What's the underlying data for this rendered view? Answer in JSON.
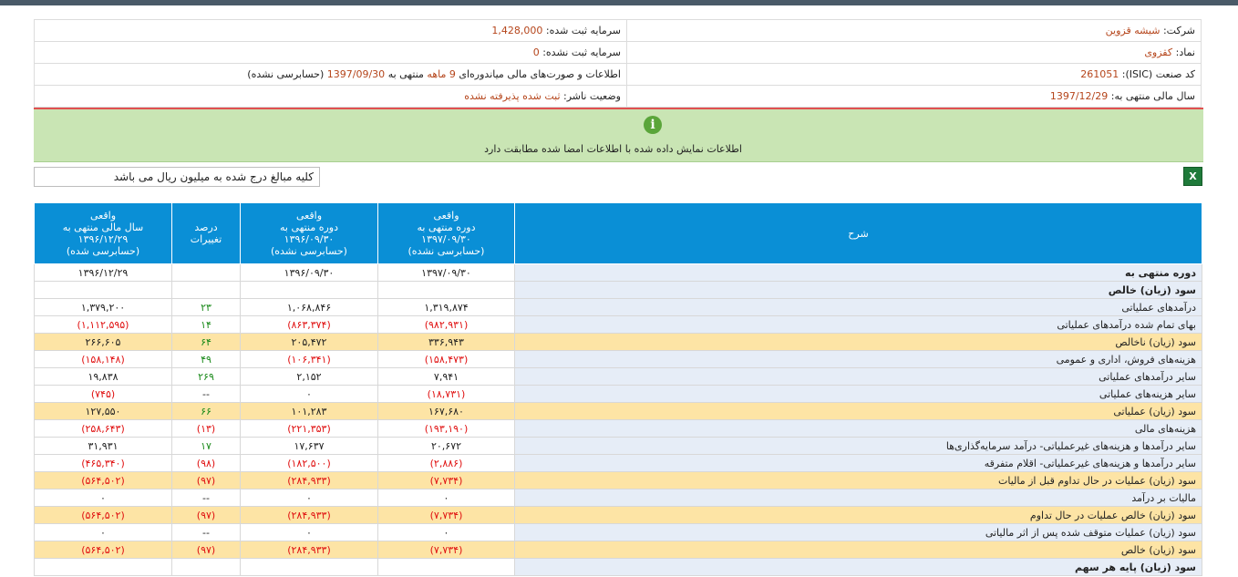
{
  "company": {
    "name_label": "شرکت:",
    "name_value": "شیشه قزوین",
    "capital_label": "سرمایه ثبت شده:",
    "capital_value": "1,428,000",
    "symbol_label": "نماد:",
    "symbol_value": "کقزوی",
    "unreg_capital_label": "سرمایه ثبت نشده:",
    "unreg_capital_value": "0",
    "isic_label": "کد صنعت (ISIC):",
    "isic_value": "261051",
    "report_desc_prefix": "اطلاعات و صورت‌های مالی میاندوره‌ای",
    "report_desc_period": "9 ماهه",
    "report_desc_mid": "منتهی به",
    "report_desc_date": "1397/09/30",
    "report_desc_suffix": "(حسابرسی نشده)",
    "fy_label": "سال مالی منتهی به:",
    "fy_value": "1397/12/29",
    "status_label": "وضعیت ناشر:",
    "status_value": "ثبت شده پذیرفته نشده"
  },
  "notice": {
    "icon": "info-icon",
    "icon_glyph": "i",
    "message": "اطلاعات نمایش داده شده با اطلاعات امضا شده مطابقت دارد"
  },
  "unit_note": "کلیه مبالغ درج شده به میلیون ریال می باشد",
  "excel": {
    "icon": "excel-icon",
    "glyph": "X"
  },
  "table": {
    "headers": {
      "desc": "شرح",
      "c1_l1": "واقعی",
      "c1_l2": "دوره منتهی به",
      "c1_l3": "۱۳۹۷/۰۹/۳۰",
      "c1_l4": "(حسابرسی نشده)",
      "c2_l1": "واقعی",
      "c2_l2": "دوره منتهی به",
      "c2_l3": "۱۳۹۶/۰۹/۳۰",
      "c2_l4": "(حسابرسی نشده)",
      "c3_l1": "درصد",
      "c3_l2": "تغییرات",
      "c4_l1": "واقعی",
      "c4_l2": "سال مالی منتهی به",
      "c4_l3": "۱۳۹۶/۱۲/۲۹",
      "c4_l4": "(حسابرسی شده)"
    },
    "rows": [
      {
        "label": "دوره منتهی به",
        "c1": "۱۳۹۷/۰۹/۳۰",
        "c2": "۱۳۹۶/۰۹/۳۰",
        "c3": "",
        "c4": "۱۳۹۶/۱۲/۲۹"
      },
      {
        "label": "سود (زیان) خالص",
        "c1": "",
        "c2": "",
        "c3": "",
        "c4": ""
      },
      {
        "label": "درآمدهای عملیاتی",
        "c1": "۱,۳۱۹,۸۷۴",
        "c2": "۱,۰۶۸,۸۴۶",
        "c3": "۲۳",
        "c4": "۱,۳۷۹,۲۰۰"
      },
      {
        "label": "بهای تمام شده درآمدهای عملیاتی",
        "c1": "(۹۸۲,۹۳۱)",
        "c2": "(۸۶۳,۳۷۴)",
        "c3": "۱۴",
        "c4": "(۱,۱۱۲,۵۹۵)"
      },
      {
        "label": "سود (زیان) ناخالص",
        "c1": "۳۳۶,۹۴۳",
        "c2": "۲۰۵,۴۷۲",
        "c3": "۶۴",
        "c4": "۲۶۶,۶۰۵"
      },
      {
        "label": "هزینه‌های فروش، اداری و عمومی",
        "c1": "(۱۵۸,۴۷۳)",
        "c2": "(۱۰۶,۳۴۱)",
        "c3": "۴۹",
        "c4": "(۱۵۸,۱۴۸)"
      },
      {
        "label": "سایر درآمدهای عملیاتی",
        "c1": "۷,۹۴۱",
        "c2": "۲,۱۵۲",
        "c3": "۲۶۹",
        "c4": "۱۹,۸۳۸"
      },
      {
        "label": "سایر هزینه‌های عملیاتی",
        "c1": "(۱۸,۷۳۱)",
        "c2": "۰",
        "c3": "--",
        "c4": "(۷۴۵)"
      },
      {
        "label": "سود (زیان) عملیاتی",
        "c1": "۱۶۷,۶۸۰",
        "c2": "۱۰۱,۲۸۳",
        "c3": "۶۶",
        "c4": "۱۲۷,۵۵۰"
      },
      {
        "label": "هزینه‌های مالی",
        "c1": "(۱۹۳,۱۹۰)",
        "c2": "(۲۲۱,۳۵۳)",
        "c3": "(۱۳)",
        "c4": "(۲۵۸,۶۴۳)"
      },
      {
        "label": "سایر درآمدها و هزینه‌های غیرعملیاتی- درآمد سرمایه‌گذاری‌ها",
        "c1": "۲۰,۶۷۲",
        "c2": "۱۷,۶۳۷",
        "c3": "۱۷",
        "c4": "۳۱,۹۳۱"
      },
      {
        "label": "سایر درآمدها و هزینه‌های غیرعملیاتی- اقلام متفرقه",
        "c1": "(۲,۸۸۶)",
        "c2": "(۱۸۲,۵۰۰)",
        "c3": "(۹۸)",
        "c4": "(۴۶۵,۳۴۰)"
      },
      {
        "label": "سود (زیان) عملیات در حال تداوم قبل از مالیات",
        "c1": "(۷,۷۳۴)",
        "c2": "(۲۸۴,۹۳۳)",
        "c3": "(۹۷)",
        "c4": "(۵۶۴,۵۰۲)"
      },
      {
        "label": "مالیات بر درآمد",
        "c1": "۰",
        "c2": "۰",
        "c3": "--",
        "c4": "۰"
      },
      {
        "label": "سود (زیان) خالص عملیات در حال تداوم",
        "c1": "(۷,۷۳۴)",
        "c2": "(۲۸۴,۹۳۳)",
        "c3": "(۹۷)",
        "c4": "(۵۶۴,۵۰۲)"
      },
      {
        "label": "سود (زیان) عملیات متوقف شده پس از اثر مالیاتی",
        "c1": "۰",
        "c2": "۰",
        "c3": "--",
        "c4": "۰"
      },
      {
        "label": "سود (زیان) خالص",
        "c1": "(۷,۷۳۴)",
        "c2": "(۲۸۴,۹۳۳)",
        "c3": "(۹۷)",
        "c4": "(۵۶۴,۵۰۲)"
      },
      {
        "label": "سود (زیان) پایه هر سهم",
        "c1": "",
        "c2": "",
        "c3": "",
        "c4": ""
      }
    ]
  }
}
